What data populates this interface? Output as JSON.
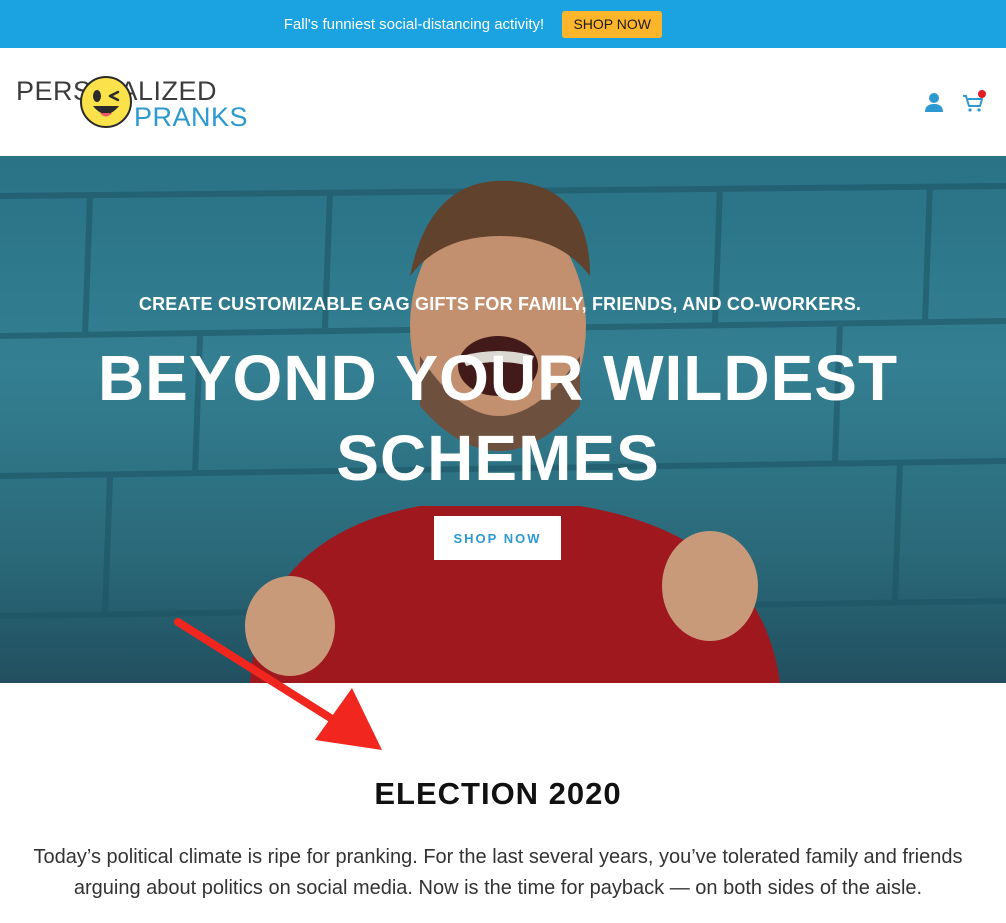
{
  "announcement": {
    "text": "Fall's funniest social-distancing activity!",
    "button_label": "SHOP NOW",
    "bar_color": "#1aa3e0",
    "button_color": "#fdb62b"
  },
  "header": {
    "logo": {
      "line1": "PERS NALIZED",
      "line2": "PRANKS",
      "face_icon": "winking-face-icon"
    },
    "icons": [
      "account-icon",
      "cart-icon"
    ],
    "cart_badge_color": "#e31b23"
  },
  "hero": {
    "subtitle": "CREATE CUSTOMIZABLE GAG GIFTS FOR FAMILY, FRIENDS, AND CO-WORKERS.",
    "title_line1": "BEYOND YOUR WILDEST",
    "title_line2": "SCHEMES",
    "button_label": "SHOP NOW"
  },
  "annotation": {
    "arrow_color": "#f0261f"
  },
  "section": {
    "title": "ELECTION 2020",
    "body_line1": "Today’s political climate is ripe for pranking. For the last several years, you’ve tolerated family and friends",
    "body_line2": "arguing about politics on social media. Now is the time for payback — on both sides of the aisle."
  }
}
